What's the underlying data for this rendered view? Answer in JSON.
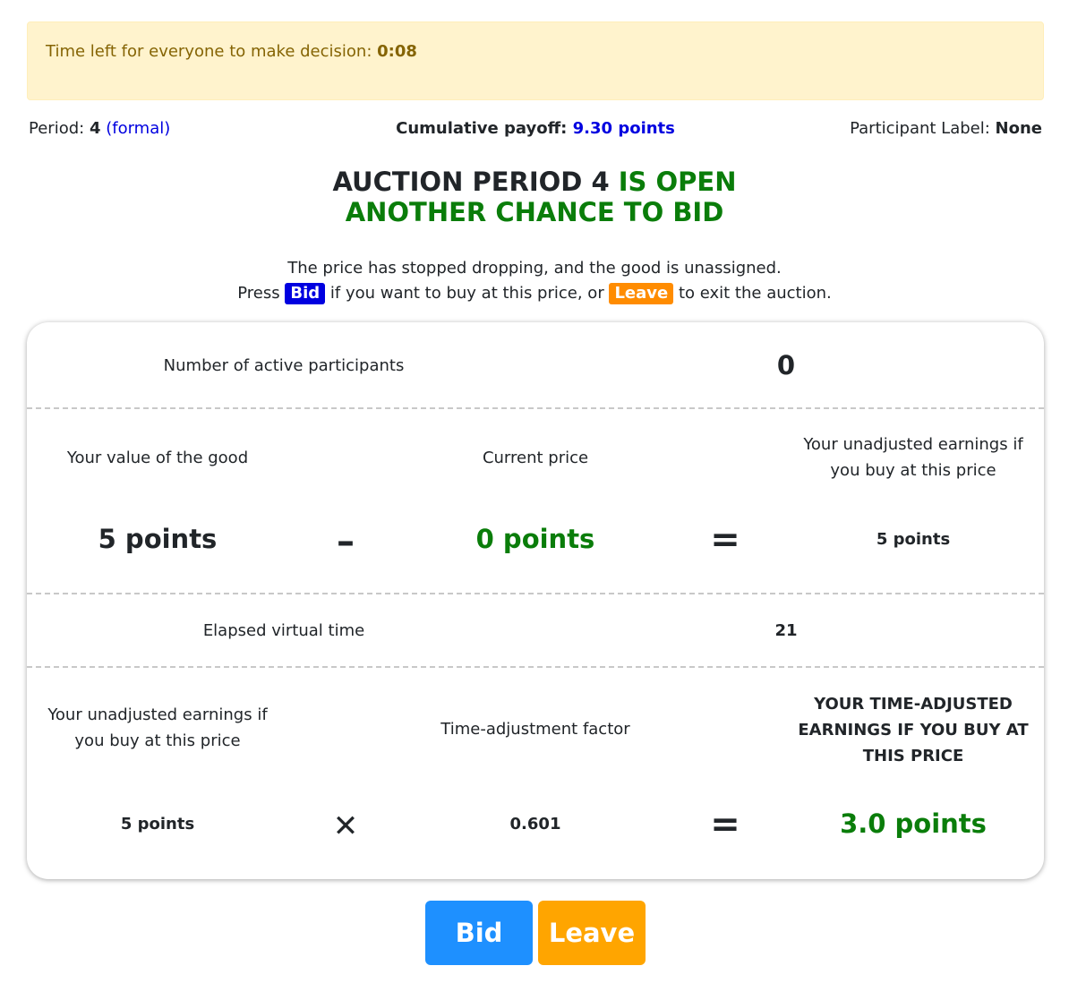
{
  "timer": {
    "label": "Time left for everyone to make decision:",
    "value": "0:08"
  },
  "info": {
    "period_label": "Period:",
    "period_value": "4",
    "period_type": "(formal)",
    "payoff_label": "Cumulative payoff:",
    "payoff_value": "9.30 points",
    "participant_label": "Participant Label:",
    "participant_value": "None"
  },
  "headline": {
    "line1_part1": "AUCTION PERIOD 4",
    "line1_part2": "IS OPEN",
    "line2": "ANOTHER CHANCE TO BID"
  },
  "instructions": {
    "line1": "The price has stopped dropping, and the good is unassigned.",
    "press": "Press",
    "bid_chip": "Bid",
    "middle": "if you want to buy at this price, or",
    "leave_chip": "Leave",
    "end": "to exit the auction."
  },
  "panel": {
    "active_label": "Number of active participants",
    "active_value": "0",
    "value_label": "Your value of the good",
    "value_amount": "5 points",
    "minus_op": "–",
    "price_label": "Current price",
    "price_amount": "0 points",
    "equals_op": "=",
    "unadjusted_label": "Your unadjusted earnings if you buy at this price",
    "unadjusted_amount": "5 points",
    "elapsed_label": "Elapsed virtual time",
    "elapsed_value": "21",
    "unadjusted_label_2": "Your unadjusted earnings if you buy at this price",
    "unadjusted_amount_2": "5 points",
    "times_op": "✕",
    "factor_label": "Time-adjustment factor",
    "factor_value": "0.601",
    "equals_op_2": "=",
    "adjusted_label": "YOUR TIME-ADJUSTED EARNINGS IF YOU BUY AT THIS PRICE",
    "adjusted_amount": "3.0 points"
  },
  "buttons": {
    "bid": "Bid",
    "leave": "Leave"
  },
  "colors": {
    "accent_blue": "#0000e0",
    "green": "#0a7d0a",
    "bid_button": "#1e90ff",
    "leave_button": "#ffa500",
    "alert_bg": "#fff3cd"
  }
}
